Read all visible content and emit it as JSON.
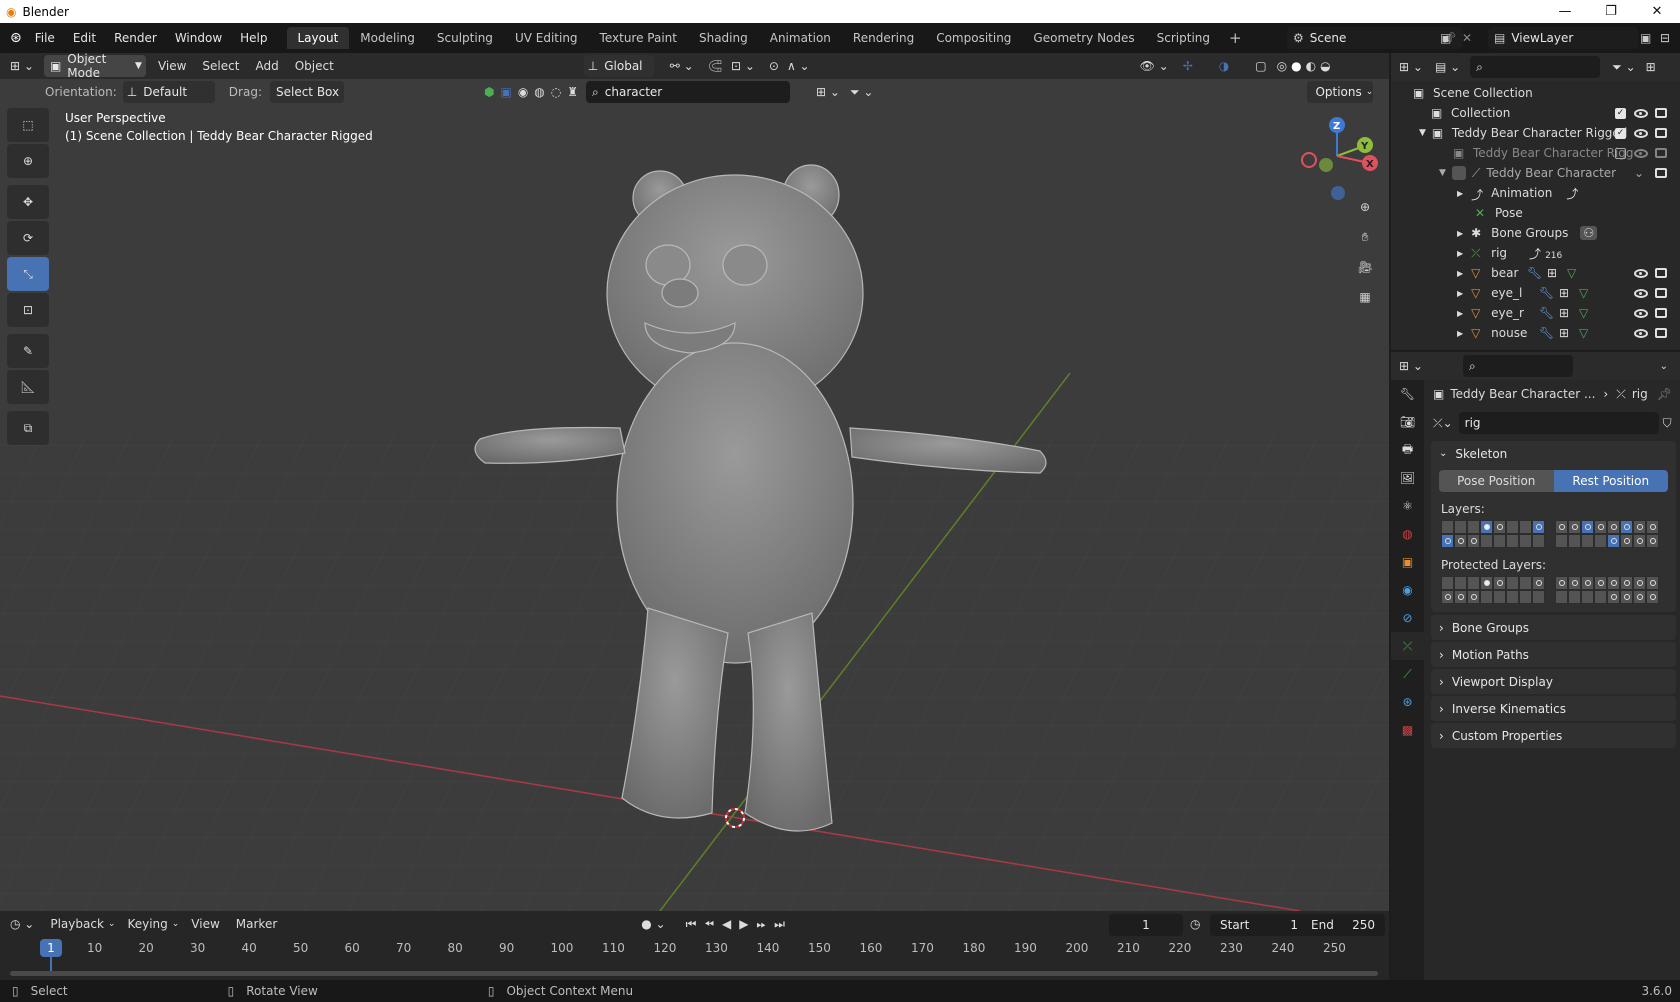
{
  "window": {
    "title": "Blender"
  },
  "menu": {
    "items": [
      "File",
      "Edit",
      "Render",
      "Window",
      "Help"
    ]
  },
  "workspaces": [
    "Layout",
    "Modeling",
    "Sculpting",
    "UV Editing",
    "Texture Paint",
    "Shading",
    "Animation",
    "Rendering",
    "Compositing",
    "Geometry Nodes",
    "Scripting"
  ],
  "workspace_active": "Layout",
  "scene": {
    "name": "Scene",
    "view_layer": "ViewLayer"
  },
  "viewport": {
    "mode": "Object Mode",
    "menus": [
      "View",
      "Select",
      "Add",
      "Object"
    ],
    "transform_orientation": "Global",
    "orientation_label": "Orientation:",
    "orientation_value": "Default",
    "drag_label": "Drag:",
    "drag_value": "Select Box",
    "search_value": "character",
    "options_label": "Options",
    "info_view": "User Perspective",
    "info_collection": "(1) Scene Collection | Teddy Bear Character Rigged",
    "gizmo_axes": {
      "x": "X",
      "y": "Y",
      "z": "Z"
    }
  },
  "outliner": {
    "root": "Scene Collection",
    "rows": [
      {
        "label": "Collection",
        "indent": 1
      },
      {
        "label": "Teddy Bear Character Rigged",
        "indent": 1
      },
      {
        "label": "Teddy Bear Character Rigg",
        "indent": 2
      },
      {
        "label": "Teddy Bear Character",
        "indent": 2
      },
      {
        "label": "Animation",
        "indent": 3
      },
      {
        "label": "Pose",
        "indent": 3
      },
      {
        "label": "Bone Groups",
        "indent": 3
      },
      {
        "label": "rig",
        "indent": 3,
        "badge": "216"
      },
      {
        "label": "bear",
        "indent": 3
      },
      {
        "label": "eye_l",
        "indent": 3
      },
      {
        "label": "eye_r",
        "indent": 3
      },
      {
        "label": "nouse",
        "indent": 3
      }
    ]
  },
  "properties": {
    "breadcrumb_object": "Teddy Bear Character ...",
    "breadcrumb_data": "rig",
    "data_name": "rig",
    "skeleton": {
      "title": "Skeleton",
      "pose_position": "Pose Position",
      "rest_position": "Rest Position",
      "active_position": "Rest Position",
      "layers_label": "Layers:",
      "protected_label": "Protected Layers:"
    },
    "panels": [
      "Bone Groups",
      "Motion Paths",
      "Viewport Display",
      "Inverse Kinematics",
      "Custom Properties"
    ]
  },
  "timeline": {
    "menus": [
      "Playback",
      "Keying",
      "View",
      "Marker"
    ],
    "current_frame": "1",
    "start_label": "Start",
    "start": "1",
    "end_label": "End",
    "end": "250",
    "ruler": [
      "1",
      "10",
      "20",
      "30",
      "40",
      "50",
      "60",
      "70",
      "80",
      "90",
      "100",
      "110",
      "120",
      "130",
      "140",
      "150",
      "160",
      "170",
      "180",
      "190",
      "200",
      "210",
      "220",
      "230",
      "240",
      "250"
    ]
  },
  "status": {
    "select": "Select",
    "rotate": "Rotate View",
    "context": "Object Context Menu",
    "version": "3.6.0"
  },
  "colors": {
    "accent": "#4772b3",
    "x_axis": "#e0515f",
    "y_axis": "#8ebd3d",
    "z_axis": "#3f79d6"
  }
}
